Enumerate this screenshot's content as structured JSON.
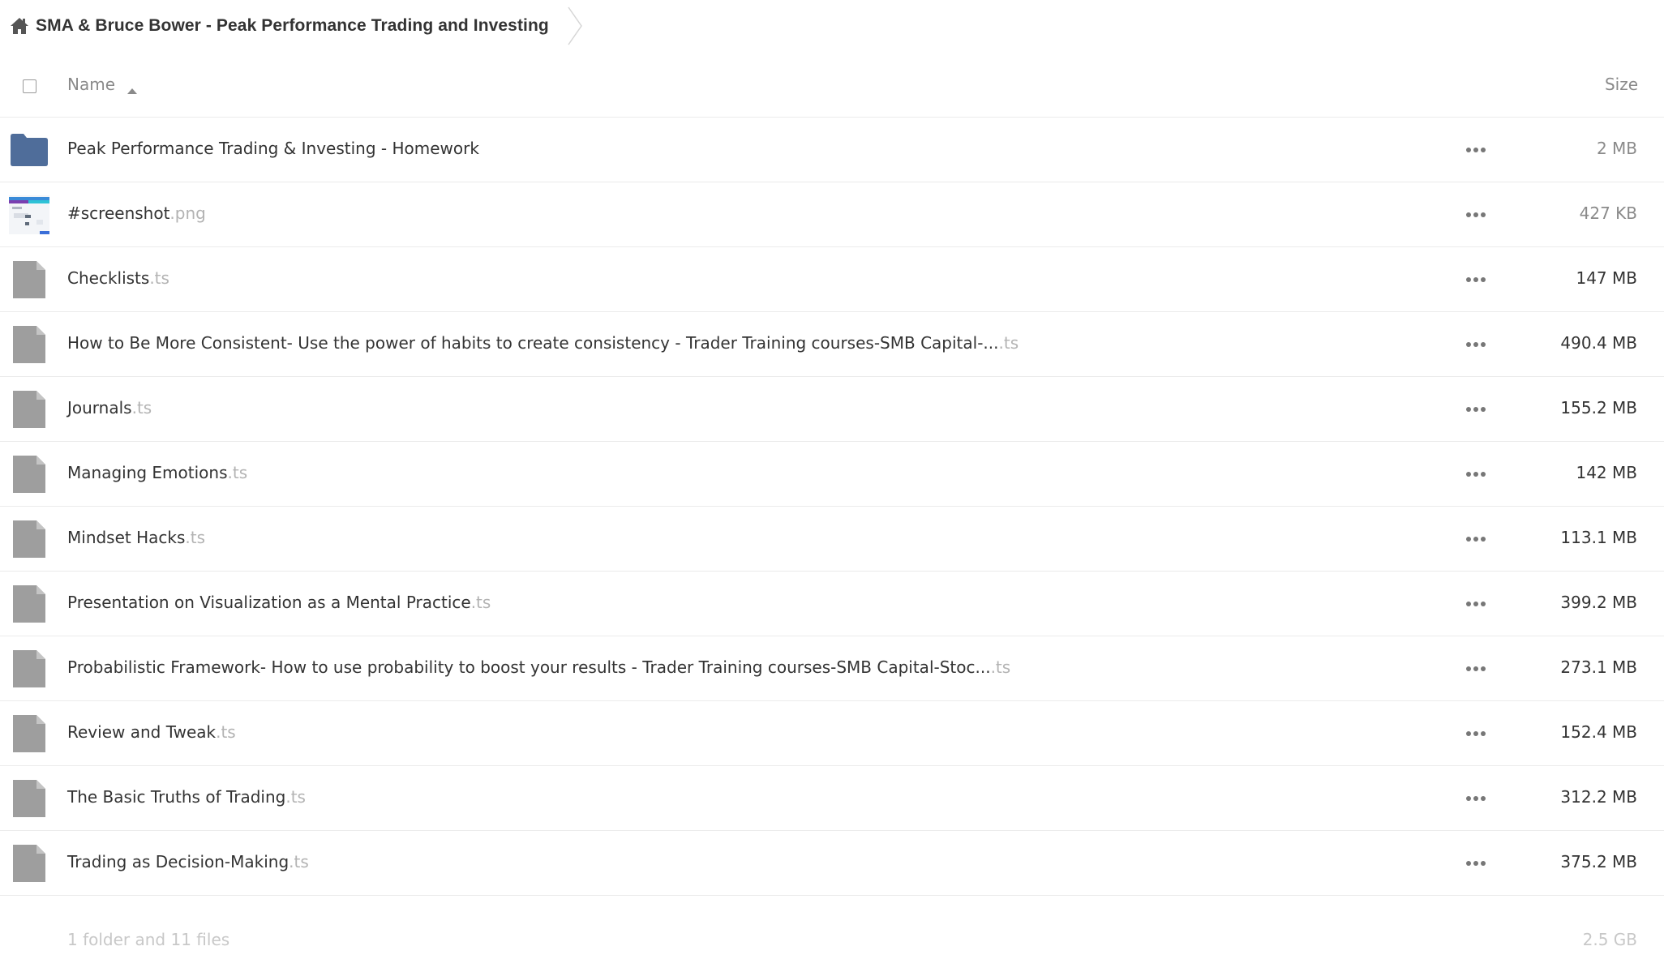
{
  "breadcrumb": {
    "home_icon": "home-icon",
    "title": "SMA & Bruce Bower - Peak Performance Trading and Investing"
  },
  "header": {
    "name_label": "Name",
    "size_label": "Size",
    "sort_icon": "sort-ascending-icon"
  },
  "colors": {
    "folder": "#4f6d9a",
    "file_icon": "#9e9e9e",
    "extension_text": "#b3b3b3"
  },
  "files": [
    {
      "type": "folder",
      "name": "Peak Performance Trading & Investing - Homework",
      "ext": "",
      "size": "2 MB"
    },
    {
      "type": "image",
      "name": "#screenshot",
      "ext": ".png",
      "size": "427 KB"
    },
    {
      "type": "file",
      "name": "Checklists",
      "ext": ".ts",
      "size": "147 MB"
    },
    {
      "type": "file",
      "name": "How to Be More Consistent- Use the power of habits to create consistency - Trader Training courses-SMB Capital-...",
      "ext": ".ts",
      "size": "490.4 MB"
    },
    {
      "type": "file",
      "name": "Journals",
      "ext": ".ts",
      "size": "155.2 MB"
    },
    {
      "type": "file",
      "name": "Managing Emotions",
      "ext": ".ts",
      "size": "142 MB"
    },
    {
      "type": "file",
      "name": "Mindset Hacks",
      "ext": ".ts",
      "size": "113.1 MB"
    },
    {
      "type": "file",
      "name": "Presentation on Visualization as a Mental Practice",
      "ext": ".ts",
      "size": "399.2 MB"
    },
    {
      "type": "file",
      "name": "Probabilistic Framework- How to use probability to boost your results - Trader Training courses-SMB Capital-Stoc...",
      "ext": ".ts",
      "size": "273.1 MB"
    },
    {
      "type": "file",
      "name": "Review and Tweak",
      "ext": ".ts",
      "size": "152.4 MB"
    },
    {
      "type": "file",
      "name": "The Basic Truths of Trading",
      "ext": ".ts",
      "size": "312.2 MB"
    },
    {
      "type": "file",
      "name": "Trading as Decision-Making",
      "ext": ".ts",
      "size": "375.2 MB"
    }
  ],
  "summary": {
    "count": "1 folder and 11 files",
    "total_size": "2.5 GB"
  }
}
